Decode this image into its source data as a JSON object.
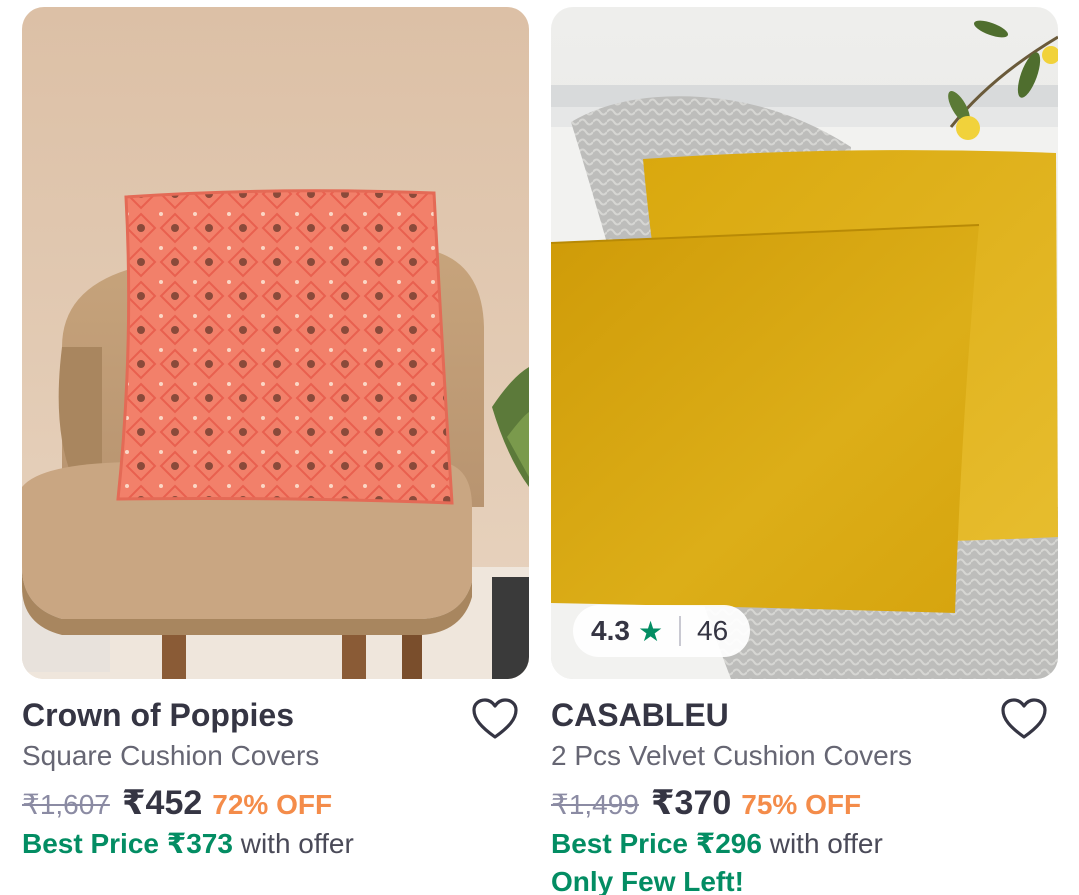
{
  "products": [
    {
      "brand": "Crown of Poppies",
      "subtitle": "Square Cushion Covers",
      "mrp": "₹1,607",
      "price": "₹452",
      "discount": "72% OFF",
      "best_price_label": "Best Price ₹373",
      "offer_text": "with offer"
    },
    {
      "brand": "CASABLEU",
      "subtitle": "2 Pcs Velvet Cushion Covers",
      "mrp": "₹1,499",
      "price": "₹370",
      "discount": "75% OFF",
      "best_price_label": "Best Price ₹296",
      "offer_text": "with offer",
      "stock_note": "Only Few Left!",
      "rating": "4.3",
      "rating_icon": "star-icon",
      "rating_count": "46"
    }
  ],
  "icons": {
    "wishlist": "heart-outline-icon"
  },
  "colors": {
    "accent_green": "#038d63",
    "discount_orange": "#f48c4a",
    "text_dark": "#353543",
    "text_muted": "#666673"
  }
}
